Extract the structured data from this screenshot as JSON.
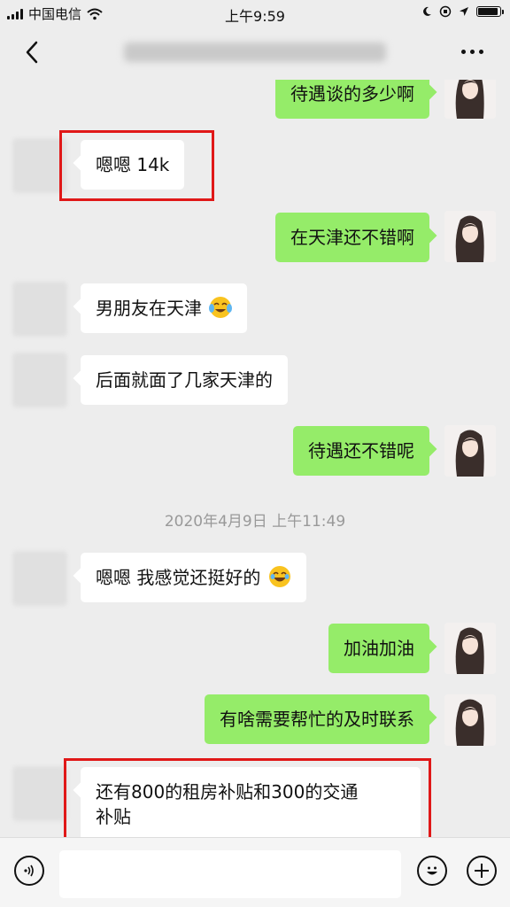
{
  "status_bar": {
    "carrier": "中国电信",
    "time": "上午9:59",
    "icons": [
      "signal-icon",
      "wifi-icon",
      "moon-icon",
      "orientation-lock-icon",
      "location-icon",
      "battery-icon"
    ]
  },
  "nav": {
    "back_icon": "chevron-left-icon",
    "more_icon": "more-dots-icon"
  },
  "messages": [
    {
      "side": "right",
      "text": "待遇谈的多少啊"
    },
    {
      "side": "left",
      "text": "嗯嗯 14k",
      "highlighted": true
    },
    {
      "side": "right",
      "text": "在天津还不错啊"
    },
    {
      "side": "left",
      "text": "男朋友在天津",
      "emoji": "crying-laughing"
    },
    {
      "side": "left",
      "text": "后面就面了几家天津的"
    },
    {
      "side": "right",
      "text": "待遇还不错呢"
    },
    {
      "side": "timestamp",
      "text": "2020年4月9日 上午11:49"
    },
    {
      "side": "left",
      "text": "嗯嗯 我感觉还挺好的",
      "emoji": "tears-of-joy"
    },
    {
      "side": "right",
      "text": "加油加油"
    },
    {
      "side": "right",
      "text": "有啥需要帮忙的及时联系"
    },
    {
      "side": "left",
      "line1": "还有800的租房补贴和300的交通",
      "line2": "补贴",
      "highlighted": true
    }
  ],
  "input_bar": {
    "voice_icon": "voice-icon",
    "emoji_icon": "emoji-icon",
    "plus_icon": "plus-icon",
    "placeholder": ""
  },
  "colors": {
    "background": "#ededed",
    "sent_bubble": "#95ec69",
    "received_bubble": "#ffffff",
    "highlight_box": "#e01818",
    "timestamp_text": "#999999"
  }
}
